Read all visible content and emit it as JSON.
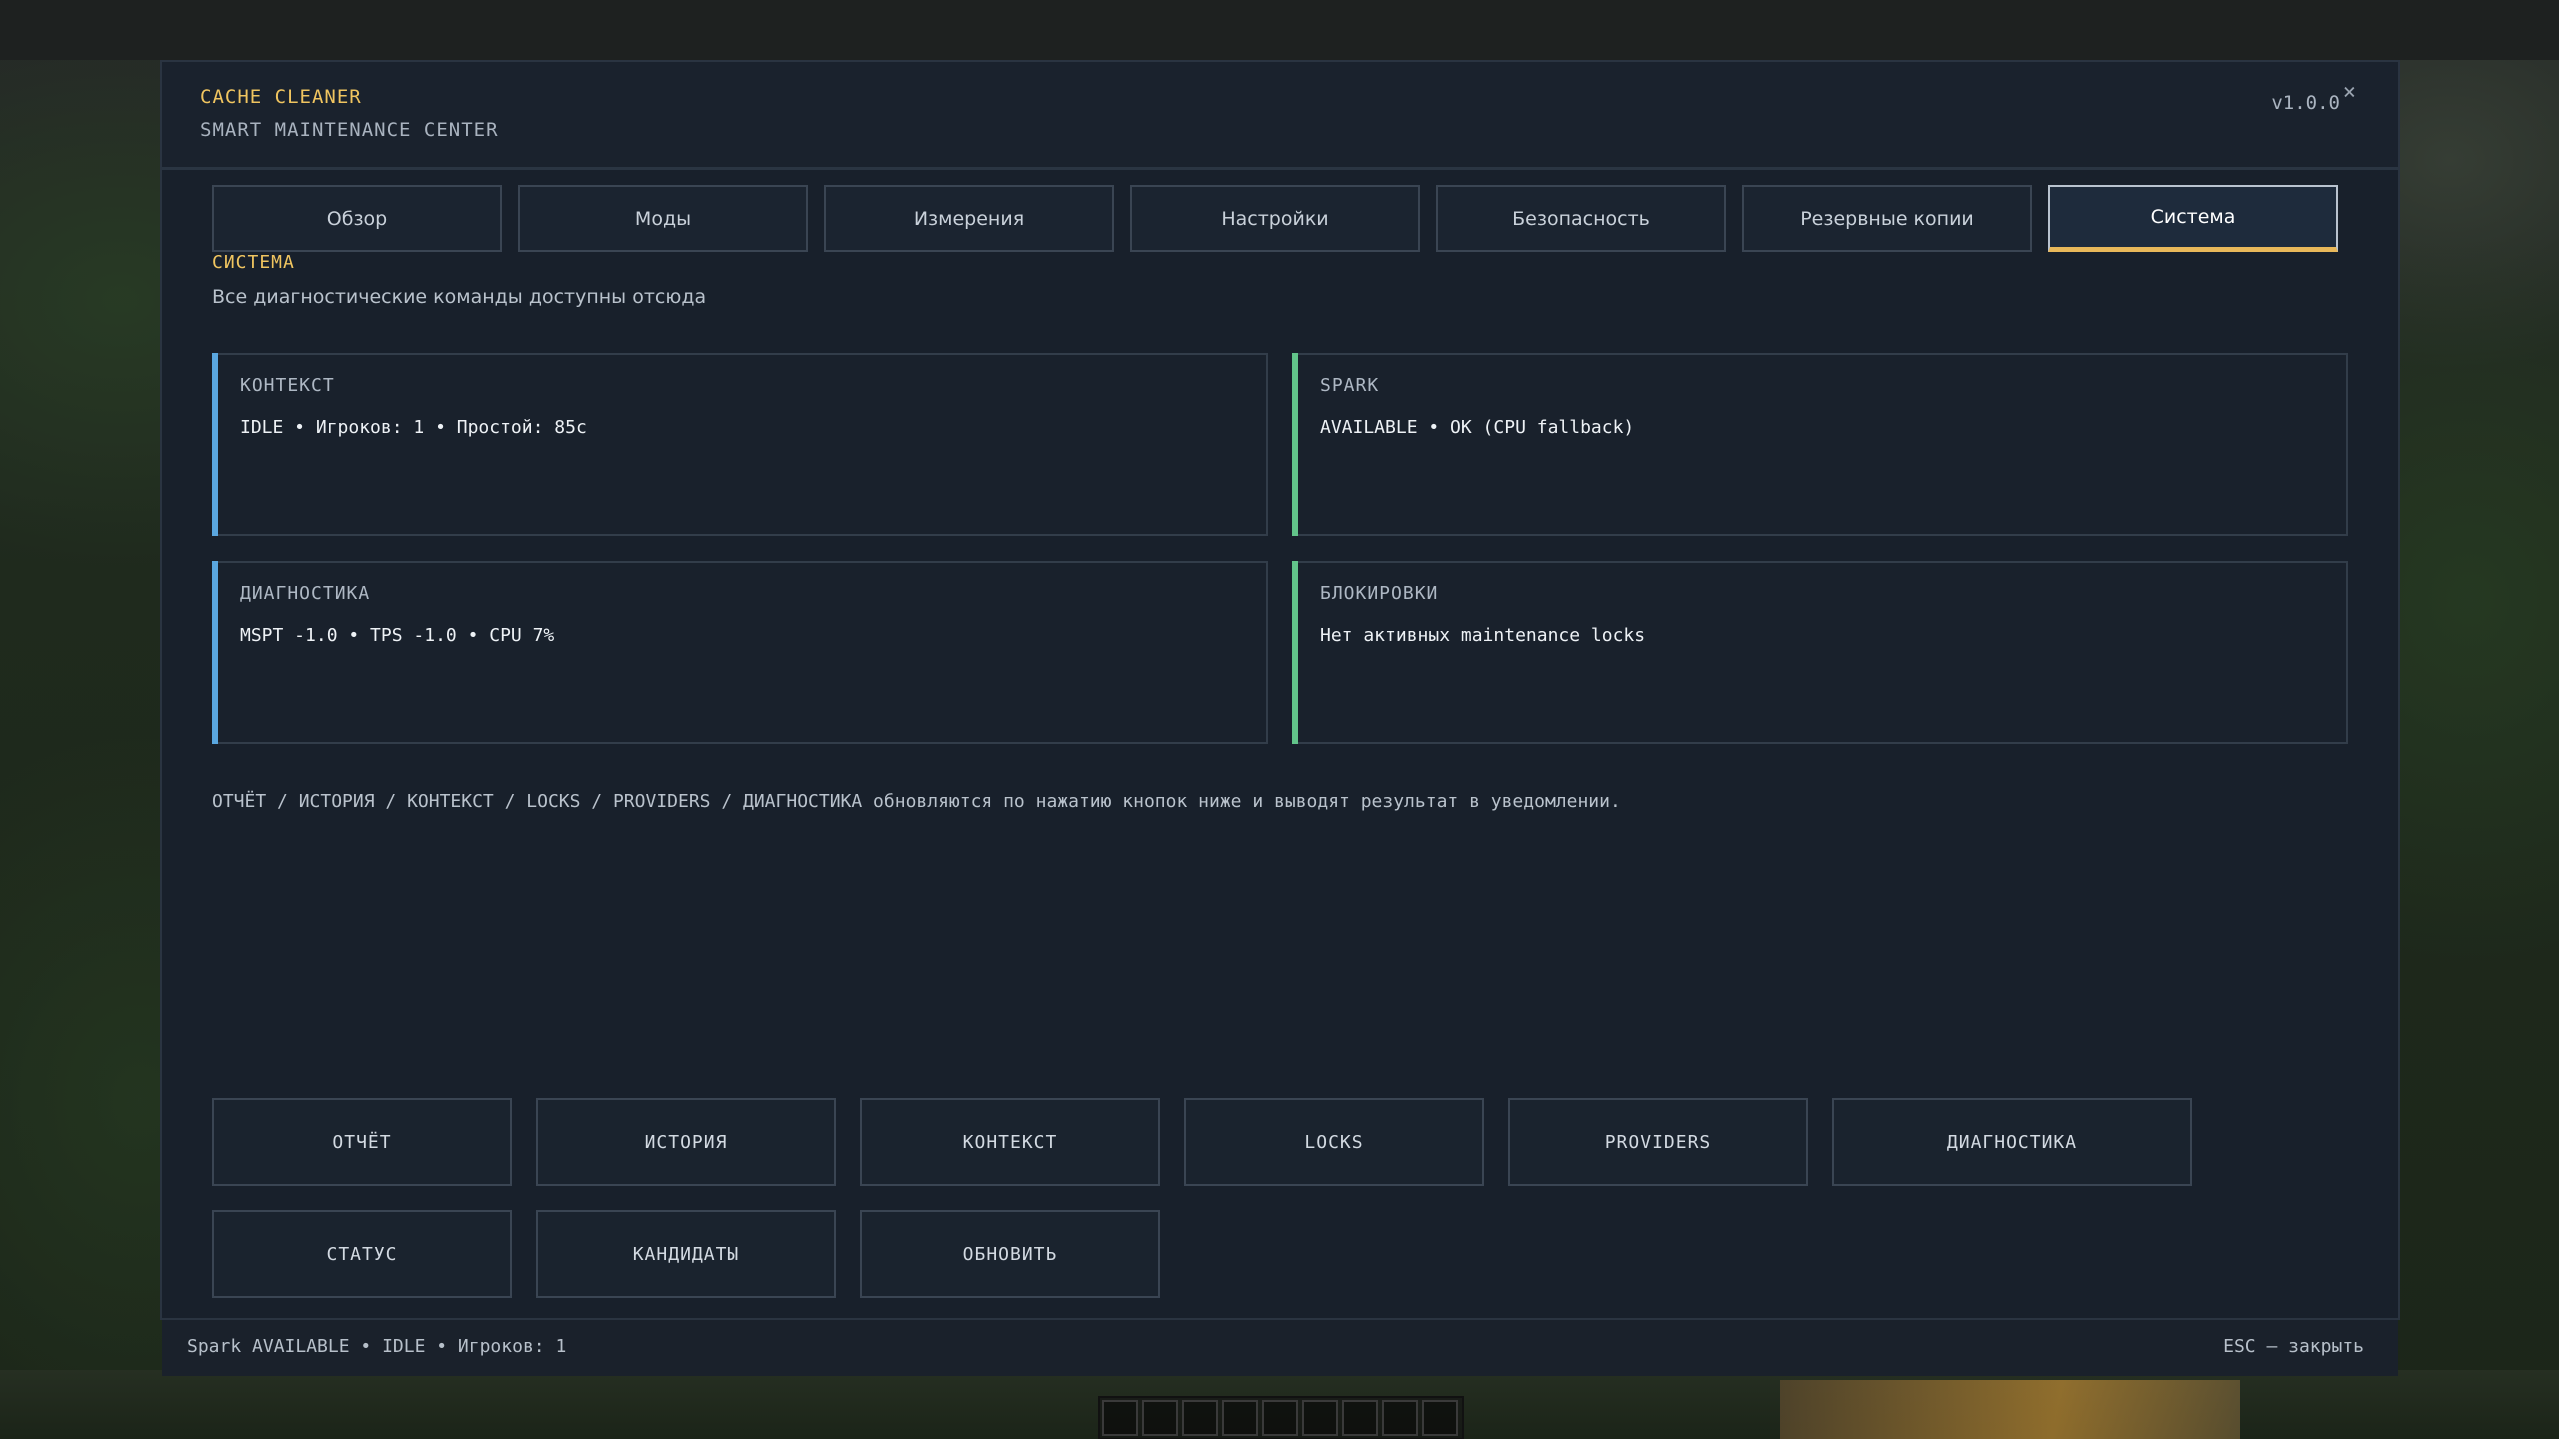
{
  "header": {
    "title": "CACHE CLEANER",
    "subtitle": "SMART MAINTENANCE CENTER",
    "version": "v1.0.0",
    "close_icon": "×"
  },
  "tabs": [
    {
      "label": "Обзор",
      "active": false
    },
    {
      "label": "Моды",
      "active": false
    },
    {
      "label": "Измерения",
      "active": false
    },
    {
      "label": "Настройки",
      "active": false
    },
    {
      "label": "Безопасность",
      "active": false
    },
    {
      "label": "Резервные копии",
      "active": false
    },
    {
      "label": "Система",
      "active": true
    }
  ],
  "section": {
    "title": "СИСТЕМА",
    "description": "Все диагностические команды доступны отсюда"
  },
  "cards": {
    "context": {
      "title": "КОНТЕКСТ",
      "value": "IDLE • Игроков: 1 • Простой: 85с",
      "accent": "#5aa7e0"
    },
    "spark": {
      "title": "SPARK",
      "value": "AVAILABLE • OK (CPU fallback)",
      "accent": "#62c48a"
    },
    "diagnostics": {
      "title": "ДИАГНОСТИКА",
      "value": "MSPT -1.0 • TPS -1.0 • CPU 7%",
      "accent": "#5aa7e0"
    },
    "locks": {
      "title": "БЛОКИРОВКИ",
      "value": "Нет активных maintenance locks",
      "accent": "#62c48a"
    }
  },
  "info_note": "ОТЧЁТ / ИСТОРИЯ / КОНТЕКСТ / LOCKS / PROVIDERS / ДИАГНОСТИКА обновляются по нажатию кнопок ниже и выводят результат в уведомлении.",
  "actions": {
    "report": "ОТЧЁТ",
    "history": "ИСТОРИЯ",
    "context": "КОНТЕКСТ",
    "locks": "LOCKS",
    "providers": "PROVIDERS",
    "diagnostics": "ДИАГНОСТИКА",
    "status": "СТАТУС",
    "candidates": "КАНДИДАТЫ",
    "refresh": "ОБНОВИТЬ"
  },
  "footer": {
    "status": "Spark AVAILABLE • IDLE • Игроков: 1",
    "hint": "ESC — закрыть"
  },
  "colors": {
    "accent_gold": "#f0c560",
    "panel_bg": "#18202b",
    "card_accent_blue": "#5aa7e0",
    "card_accent_green": "#62c48a"
  }
}
